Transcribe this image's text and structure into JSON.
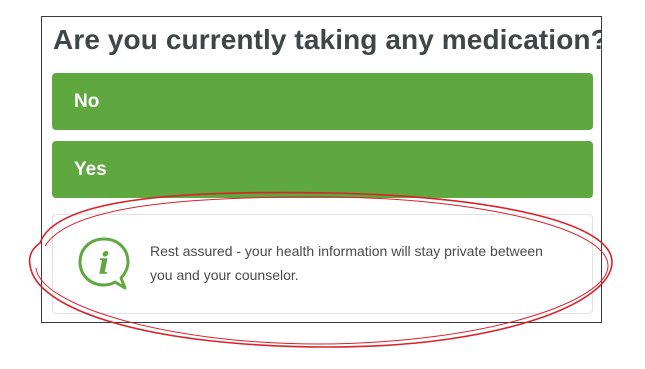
{
  "question": {
    "title": "Are you currently taking any medication?"
  },
  "answers": [
    {
      "label": "No"
    },
    {
      "label": "Yes"
    }
  ],
  "info": {
    "icon": "info-speech-bubble-icon",
    "icon_glyph": "i",
    "text_line1": "Rest assured - your health information will stay private between",
    "text_line2": "you and your counselor."
  },
  "colors": {
    "accent_green": "#5fa840",
    "annotation_red": "#d9232a",
    "title_text": "#404548"
  }
}
